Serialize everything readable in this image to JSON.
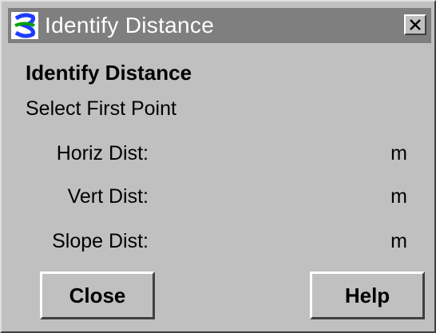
{
  "window": {
    "title": "Identify Distance",
    "icon": "app-logo-icon",
    "close_glyph": "×"
  },
  "panel": {
    "heading": "Identify Distance",
    "status": "Select First Point"
  },
  "rows": [
    {
      "label": "Horiz Dist:",
      "value": "",
      "unit": "m"
    },
    {
      "label": "Vert Dist:",
      "value": "",
      "unit": "m"
    },
    {
      "label": "Slope Dist:",
      "value": "",
      "unit": "m"
    }
  ],
  "buttons": {
    "close_label": "Close",
    "help_label": "Help"
  },
  "colors": {
    "face": "#c0c0c0",
    "titlebar": "#7f7f7f",
    "title_text": "#ffffff",
    "icon_blue": "#1e3cff",
    "icon_green": "#00a000"
  }
}
